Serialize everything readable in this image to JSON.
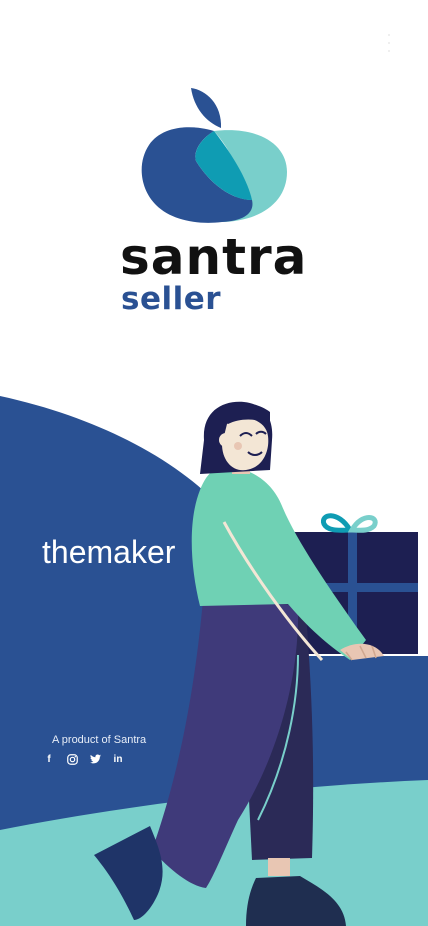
{
  "app": {
    "brand_name": "santra",
    "brand_sub": "seller"
  },
  "hero": {
    "tagline": "themaker"
  },
  "footer": {
    "product_text": "A product of Santra",
    "socials": [
      {
        "icon": "facebook-icon",
        "glyph": "f"
      },
      {
        "icon": "instagram-icon",
        "glyph": ""
      },
      {
        "icon": "twitter-icon",
        "glyph": ""
      },
      {
        "icon": "linkedin-icon",
        "glyph": "in"
      }
    ]
  },
  "colors": {
    "brand_blue": "#2A5193",
    "teal": "#0F9CB3",
    "light_teal": "#79CFCB",
    "mint": "#6FD1B4",
    "navy": "#1D1F52",
    "purple": "#3F3A7A"
  }
}
